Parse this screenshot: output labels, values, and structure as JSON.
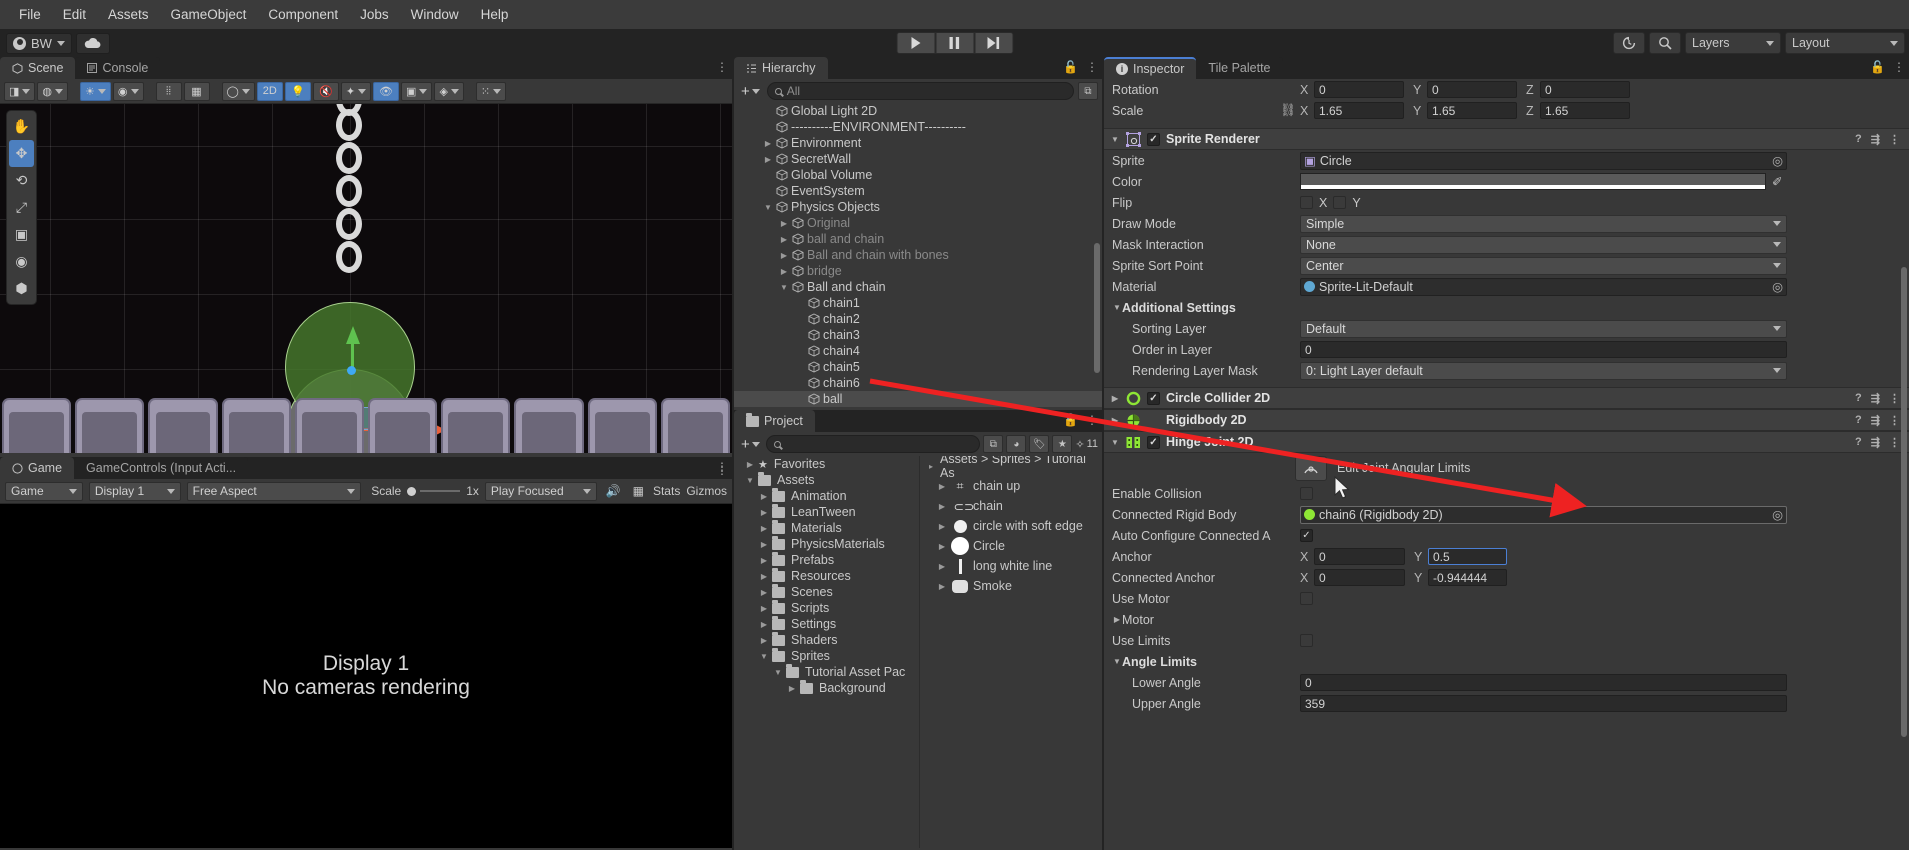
{
  "menubar": {
    "items": [
      "File",
      "Edit",
      "Assets",
      "GameObject",
      "Component",
      "Jobs",
      "Window",
      "Help"
    ]
  },
  "toolbar": {
    "account_label": "BW",
    "cloud_icon": "cloud-icon",
    "play_icon": "play-icon",
    "pause_icon": "pause-icon",
    "step_icon": "step-icon",
    "history_icon": "history-icon",
    "search_icon": "search-icon",
    "layers_label": "Layers",
    "layout_label": "Layout"
  },
  "scene": {
    "tab_label": "Scene",
    "console_tab_label": "Console",
    "toolbar": {
      "two_d_label": "2D",
      "tool_hand": "hand-tool-icon",
      "tool_move": "move-tool-icon",
      "tool_rotate": "rotate-tool-icon",
      "tool_scale": "scale-tool-icon",
      "tool_rect": "rect-tool-icon",
      "tool_transform": "transform-tool-icon",
      "tool_custom": "custom-tool-icon"
    }
  },
  "game": {
    "tab_label": "Game",
    "controls_tab_label": "GameControls (Input Acti...",
    "display_label": "Display 1",
    "aspect_label": "Free Aspect",
    "scale_label": "Scale",
    "scale_value": "1x",
    "play_focused_label": "Play Focused",
    "stats_label": "Stats",
    "gizmos_label": "Gizmos",
    "no_camera_line1": "Display 1",
    "no_camera_line2": "No cameras rendering"
  },
  "hierarchy": {
    "tab_label": "Hierarchy",
    "search_placeholder": "All",
    "items": [
      {
        "label": "Global Light 2D",
        "depth": 1,
        "arrow": "",
        "dim": false,
        "selected": false
      },
      {
        "label": "----------ENVIRONMENT----------",
        "depth": 1,
        "arrow": "",
        "dim": false,
        "selected": false
      },
      {
        "label": "Environment",
        "depth": 1,
        "arrow": "collapsed",
        "dim": false,
        "selected": false
      },
      {
        "label": "SecretWall",
        "depth": 1,
        "arrow": "collapsed",
        "dim": false,
        "selected": false
      },
      {
        "label": "Global Volume",
        "depth": 1,
        "arrow": "",
        "dim": false,
        "selected": false
      },
      {
        "label": "EventSystem",
        "depth": 1,
        "arrow": "",
        "dim": false,
        "selected": false
      },
      {
        "label": "Physics Objects",
        "depth": 1,
        "arrow": "expanded",
        "dim": false,
        "selected": false
      },
      {
        "label": "Original",
        "depth": 2,
        "arrow": "collapsed",
        "dim": true,
        "selected": false
      },
      {
        "label": "ball and chain",
        "depth": 2,
        "arrow": "collapsed",
        "dim": true,
        "selected": false
      },
      {
        "label": "Ball and chain with bones",
        "depth": 2,
        "arrow": "collapsed",
        "dim": true,
        "selected": false
      },
      {
        "label": "bridge",
        "depth": 2,
        "arrow": "collapsed",
        "dim": true,
        "selected": false
      },
      {
        "label": "Ball and chain",
        "depth": 2,
        "arrow": "expanded",
        "dim": false,
        "selected": false
      },
      {
        "label": "chain1",
        "depth": 3,
        "arrow": "",
        "dim": false,
        "selected": false
      },
      {
        "label": "chain2",
        "depth": 3,
        "arrow": "",
        "dim": false,
        "selected": false
      },
      {
        "label": "chain3",
        "depth": 3,
        "arrow": "",
        "dim": false,
        "selected": false
      },
      {
        "label": "chain4",
        "depth": 3,
        "arrow": "",
        "dim": false,
        "selected": false
      },
      {
        "label": "chain5",
        "depth": 3,
        "arrow": "",
        "dim": false,
        "selected": false
      },
      {
        "label": "chain6",
        "depth": 3,
        "arrow": "",
        "dim": false,
        "selected": false
      },
      {
        "label": "ball",
        "depth": 3,
        "arrow": "",
        "dim": false,
        "selected": true
      }
    ]
  },
  "project": {
    "tab_label": "Project",
    "favorites_count": "11",
    "breadcrumb": "Assets  >  Sprites  >  Tutorial As",
    "tree": [
      {
        "label": "Favorites",
        "depth": 0,
        "arrow": "collapsed",
        "icon": "star-icon"
      },
      {
        "label": "Assets",
        "depth": 0,
        "arrow": "expanded",
        "icon": "folder-icon"
      },
      {
        "label": "Animation",
        "depth": 1,
        "arrow": "collapsed",
        "icon": "folder-icon"
      },
      {
        "label": "LeanTween",
        "depth": 1,
        "arrow": "collapsed",
        "icon": "folder-icon"
      },
      {
        "label": "Materials",
        "depth": 1,
        "arrow": "collapsed",
        "icon": "folder-icon"
      },
      {
        "label": "PhysicsMaterials",
        "depth": 1,
        "arrow": "collapsed",
        "icon": "folder-icon"
      },
      {
        "label": "Prefabs",
        "depth": 1,
        "arrow": "collapsed",
        "icon": "folder-icon"
      },
      {
        "label": "Resources",
        "depth": 1,
        "arrow": "collapsed",
        "icon": "folder-icon"
      },
      {
        "label": "Scenes",
        "depth": 1,
        "arrow": "collapsed",
        "icon": "folder-icon"
      },
      {
        "label": "Scripts",
        "depth": 1,
        "arrow": "collapsed",
        "icon": "folder-icon"
      },
      {
        "label": "Settings",
        "depth": 1,
        "arrow": "collapsed",
        "icon": "folder-icon"
      },
      {
        "label": "Shaders",
        "depth": 1,
        "arrow": "collapsed",
        "icon": "folder-icon"
      },
      {
        "label": "Sprites",
        "depth": 1,
        "arrow": "expanded",
        "icon": "folder-icon"
      },
      {
        "label": "Tutorial Asset Pac",
        "depth": 2,
        "arrow": "expanded",
        "icon": "folder-icon"
      },
      {
        "label": "Background",
        "depth": 3,
        "arrow": "collapsed",
        "icon": "folder-icon"
      }
    ],
    "assets": [
      {
        "label": "chain up",
        "icon": "chain-up-sprite"
      },
      {
        "label": "chain",
        "icon": "chain-sprite"
      },
      {
        "label": "circle with soft edge",
        "icon": "circle-soft-sprite"
      },
      {
        "label": "Circle",
        "icon": "circle-sprite"
      },
      {
        "label": "long white line",
        "icon": "line-sprite"
      },
      {
        "label": "Smoke",
        "icon": "smoke-sprite"
      }
    ]
  },
  "inspector": {
    "tab_label": "Inspector",
    "tile_palette_tab_label": "Tile Palette",
    "transform": {
      "rotation_label": "Rotation",
      "rotation": {
        "x_axis": "X",
        "x": "0",
        "y_axis": "Y",
        "y": "0",
        "z_axis": "Z",
        "z": "0"
      },
      "scale_label": "Scale",
      "scale": {
        "x_axis": "X",
        "x": "1.65",
        "y_axis": "Y",
        "y": "1.65",
        "z_axis": "Z",
        "z": "1.65"
      }
    },
    "sprite_renderer": {
      "title": "Sprite Renderer",
      "enabled": true,
      "rows": [
        {
          "label": "Sprite",
          "value": "Circle",
          "type": "object"
        },
        {
          "label": "Color",
          "value": "",
          "type": "color"
        },
        {
          "label": "Flip",
          "value": "",
          "type": "flip",
          "x_label": "X",
          "y_label": "Y"
        },
        {
          "label": "Draw Mode",
          "value": "Simple",
          "type": "dropdown"
        },
        {
          "label": "Mask Interaction",
          "value": "None",
          "type": "dropdown"
        },
        {
          "label": "Sprite Sort Point",
          "value": "Center",
          "type": "dropdown"
        },
        {
          "label": "Material",
          "value": "Sprite-Lit-Default",
          "type": "object"
        }
      ],
      "additional_settings": {
        "title": "Additional Settings",
        "rows": [
          {
            "label": "Sorting Layer",
            "value": "Default",
            "type": "dropdown"
          },
          {
            "label": "Order in Layer",
            "value": "0",
            "type": "field"
          },
          {
            "label": "Rendering Layer Mask",
            "value": "0: Light Layer default",
            "type": "dropdown"
          }
        ]
      }
    },
    "circle_collider": {
      "title": "Circle Collider 2D",
      "enabled": true
    },
    "rigidbody": {
      "title": "Rigidbody 2D",
      "enabled": true
    },
    "hinge_joint": {
      "title": "Hinge Joint 2D",
      "enabled": true,
      "edit_button_label": "Edit Joint Angular Limits",
      "rows": [
        {
          "label": "Enable Collision",
          "type": "checkbox",
          "checked": false
        },
        {
          "label": "Connected Rigid Body",
          "type": "object",
          "value": "chain6 (Rigidbody 2D)"
        },
        {
          "label": "Auto Configure Connected A",
          "type": "checkbox",
          "checked": true
        },
        {
          "label": "Anchor",
          "type": "vec2",
          "x_axis": "X",
          "x": "0",
          "y_axis": "Y",
          "y": "0.5",
          "focused": true
        },
        {
          "label": "Connected Anchor",
          "type": "vec2",
          "x_axis": "X",
          "x": "0",
          "y_axis": "Y",
          "y": "-0.944444"
        },
        {
          "label": "Use Motor",
          "type": "checkbox",
          "checked": false
        },
        {
          "label": "Motor",
          "type": "foldout"
        },
        {
          "label": "Use Limits",
          "type": "checkbox",
          "checked": false
        },
        {
          "label": "Angle Limits",
          "type": "foldout-open"
        },
        {
          "label": "Lower Angle",
          "type": "field",
          "value": "0"
        },
        {
          "label": "Upper Angle",
          "type": "field",
          "value": "359"
        }
      ]
    }
  },
  "colors": {
    "accent": "#4b7fd4",
    "panel_bg": "#383838",
    "window_bg": "#232323",
    "annotation_red": "#ee2222",
    "collider_green": "#8ee635"
  }
}
